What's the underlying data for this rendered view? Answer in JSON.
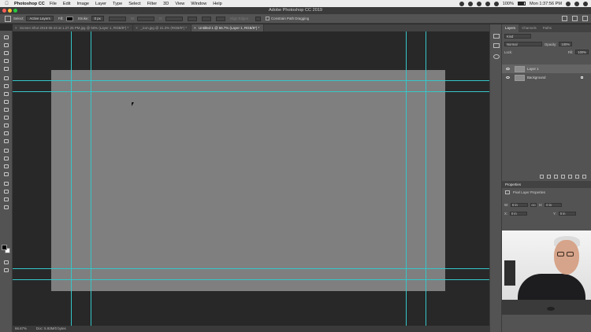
{
  "menubar": {
    "app_name": "Photoshop CC",
    "menus": [
      "File",
      "Edit",
      "Image",
      "Layer",
      "Type",
      "Select",
      "Filter",
      "3D",
      "View",
      "Window",
      "Help"
    ],
    "battery": "100%",
    "clock": "Mon 1:37:56 PM"
  },
  "window": {
    "title": "Adobe Photoshop CC 2019"
  },
  "options": {
    "select_label": "Select:",
    "select_value": "Active Layers",
    "fill_label": "Fill:",
    "stroke_label": "Stroke:",
    "stroke_value": "0 px",
    "w_label": "W:",
    "h_label": "H:",
    "align_edges": "Align Edges",
    "constrain_path": "Constrain Path Dragging"
  },
  "tabs": [
    {
      "label": "Screen Shot 2019-06-24 at 1.27.25 PM.jpg @ 50% (Layer 1, RGB/8*) *"
    },
    {
      "label": "_icon.jpg @ 21.3% (RGB/8*) *"
    },
    {
      "label": "Untitled-1 @ 66.7% (Layer 1, RGB/8*) *"
    }
  ],
  "status": {
    "zoom": "66.67%",
    "doc": "Doc: 5.93M/0 bytes"
  },
  "layers_panel": {
    "tabs": [
      "Layers",
      "Channels",
      "Paths"
    ],
    "kind_label": "Kind",
    "blend_mode": "Normal",
    "opacity_label": "Opacity:",
    "opacity_value": "100%",
    "lock_label": "Lock:",
    "fill_label": "Fill:",
    "fill_value": "100%",
    "layers": [
      {
        "name": "Layer 1",
        "selected": true
      },
      {
        "name": "Background",
        "selected": false
      }
    ]
  },
  "properties_panel": {
    "title": "Properties",
    "subtitle": "Pixel Layer Properties",
    "w_label": "W:",
    "w_value": "0 in",
    "h_label": "H:",
    "h_value": "0 in",
    "x_label": "X:",
    "x_value": "0 in",
    "y_label": "Y:",
    "y_value": "0 in",
    "go_label": "GO"
  },
  "colors": {
    "guide": "#35c6c9",
    "canvas": "#7f7f7f",
    "pasteboard": "#282828",
    "panel": "#535353"
  }
}
